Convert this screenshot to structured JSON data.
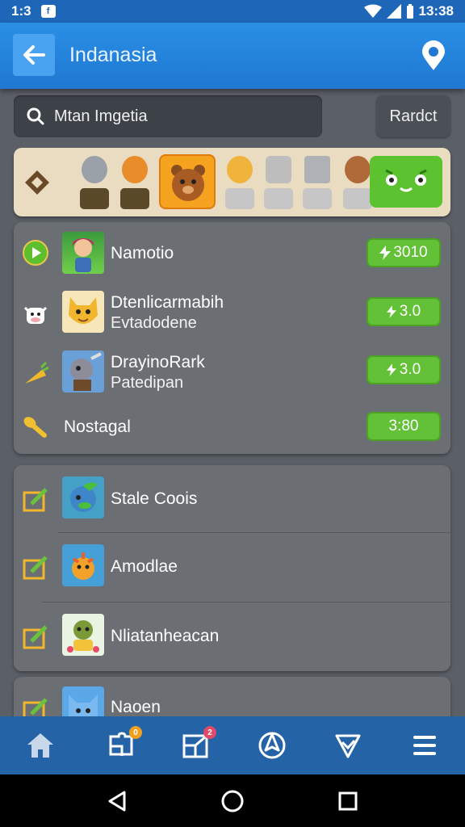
{
  "status": {
    "left_time": "1:3",
    "right_time": "13:38",
    "notif": "f"
  },
  "header": {
    "title": "Indanasia"
  },
  "search": {
    "placeholder": "Mtan Imgetia",
    "random_label": "Rardct"
  },
  "card1": [
    {
      "title": "Namotio",
      "pill": "3010",
      "icon": "play-circle-icon"
    },
    {
      "title": "Dtenlicarmabih",
      "sub": "Evtadodene",
      "pill": "3.0",
      "icon": "cow-icon"
    },
    {
      "title": "DrayinoRark",
      "sub": "Patedipan",
      "pill": "3.0",
      "icon": "carrot-icon"
    },
    {
      "title": "Nostagal",
      "pill": "3:80",
      "icon": "key-icon"
    }
  ],
  "card2": [
    {
      "title": "Stale Coois",
      "icon": "edit-icon"
    },
    {
      "title": "Amodlae",
      "icon": "edit-icon"
    },
    {
      "title": "Nliatanheacan",
      "icon": "edit-icon"
    }
  ],
  "card3": [
    {
      "title": "Naoen",
      "icon": "edit-icon"
    }
  ],
  "nav": {
    "badge_games": "0",
    "badge_map": "2"
  },
  "colors": {
    "accent": "#1f78d2",
    "pill": "#62c136",
    "card": "#6b6e73"
  }
}
